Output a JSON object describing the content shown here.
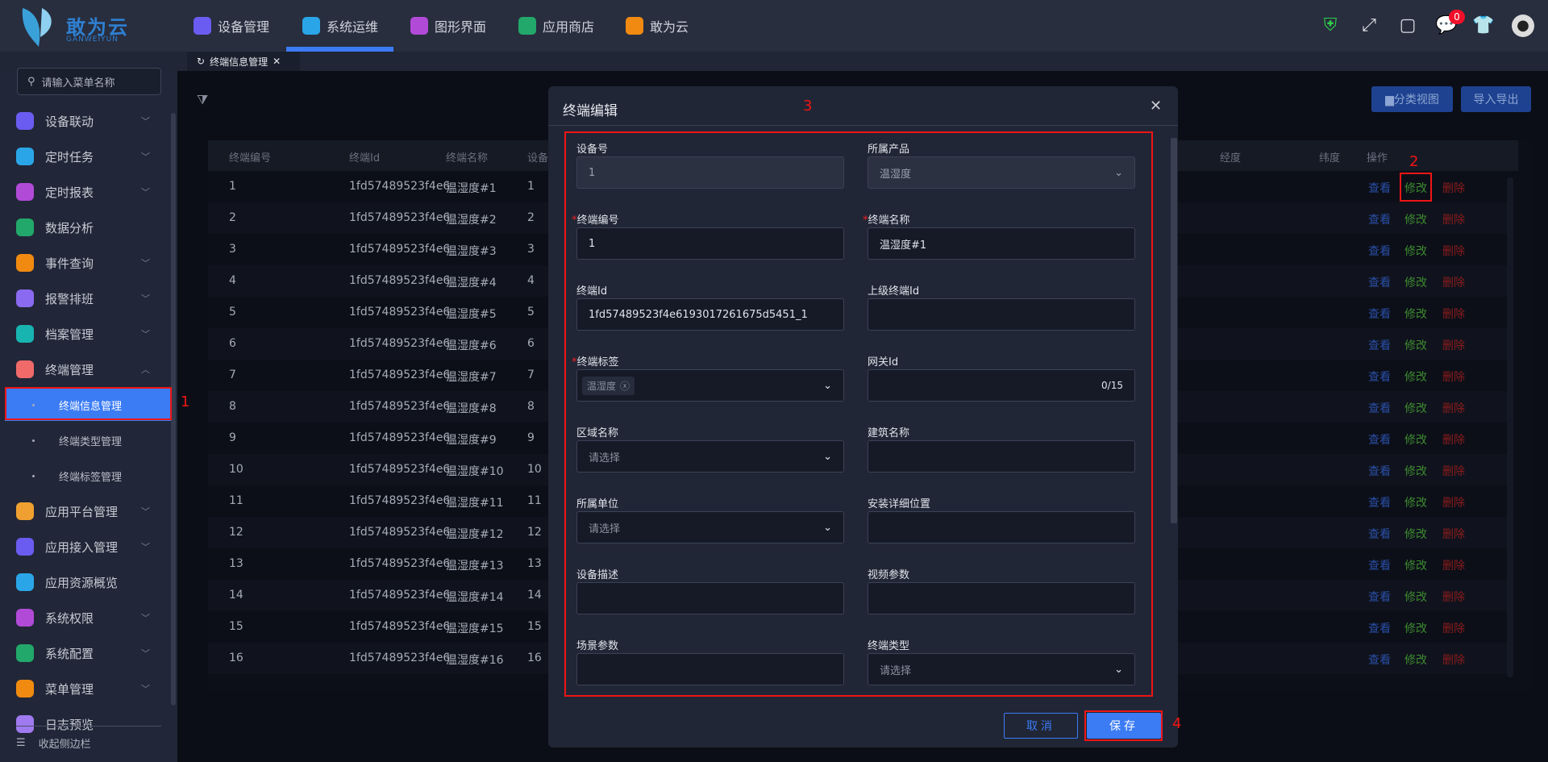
{
  "header": {
    "logo_text": "敢为云",
    "logo_sub": "GANWEIYUN",
    "nav": [
      {
        "label": "设备管理",
        "color": "#6a5cf0"
      },
      {
        "label": "系统运维",
        "color": "#2aa6e8"
      },
      {
        "label": "图形界面",
        "color": "#b24ad8"
      },
      {
        "label": "应用商店",
        "color": "#22a86a"
      },
      {
        "label": "敢为云",
        "color": "#f08a10"
      }
    ],
    "message_count": "0"
  },
  "tabs": [
    {
      "label": "终端信息管理",
      "close": "✕"
    }
  ],
  "sidebar": {
    "search_placeholder": "请输入菜单名称",
    "items": [
      {
        "label": "设备联动",
        "color": "#6a5cf0",
        "chev": "﹀"
      },
      {
        "label": "定时任务",
        "color": "#2aa6e8",
        "chev": "﹀"
      },
      {
        "label": "定时报表",
        "color": "#b24ad8",
        "chev": "﹀"
      },
      {
        "label": "数据分析",
        "color": "#22a86a",
        "chev": ""
      },
      {
        "label": "事件查询",
        "color": "#f08a10",
        "chev": "﹀"
      },
      {
        "label": "报警排班",
        "color": "#8a6af0",
        "chev": "﹀"
      },
      {
        "label": "档案管理",
        "color": "#18b4b0",
        "chev": "﹀"
      },
      {
        "label": "终端管理",
        "color": "#f06a6a",
        "chev": "︿"
      }
    ],
    "subitems": [
      "终端信息管理",
      "终端类型管理",
      "终端标签管理"
    ],
    "items2": [
      {
        "label": "应用平台管理",
        "color": "#f0a030",
        "chev": "﹀"
      },
      {
        "label": "应用接入管理",
        "color": "#6a5cf0",
        "chev": "﹀"
      },
      {
        "label": "应用资源概览",
        "color": "#2aa6e8",
        "chev": ""
      },
      {
        "label": "系统权限",
        "color": "#b24ad8",
        "chev": "﹀"
      },
      {
        "label": "系统配置",
        "color": "#22a86a",
        "chev": "﹀"
      },
      {
        "label": "菜单管理",
        "color": "#f08a10",
        "chev": "﹀"
      },
      {
        "label": "日志预览",
        "color": "#a07af0",
        "chev": ""
      }
    ],
    "collapse_label": "收起侧边栏"
  },
  "toolbar": {
    "category_view": "▆分类视图",
    "import_export": "导入导出"
  },
  "table": {
    "columns": [
      "终端编号",
      "终端Id",
      "终端名称",
      "设备",
      "经度",
      "纬度",
      "操作"
    ],
    "rows": [
      [
        "1",
        "1fd57489523f4e6",
        "温湿度#1",
        "1"
      ],
      [
        "2",
        "1fd57489523f4e6",
        "温湿度#2",
        "2"
      ],
      [
        "3",
        "1fd57489523f4e6",
        "温湿度#3",
        "3"
      ],
      [
        "4",
        "1fd57489523f4e6",
        "温湿度#4",
        "4"
      ],
      [
        "5",
        "1fd57489523f4e6",
        "温湿度#5",
        "5"
      ],
      [
        "6",
        "1fd57489523f4e6",
        "温湿度#6",
        "6"
      ],
      [
        "7",
        "1fd57489523f4e6",
        "温湿度#7",
        "7"
      ],
      [
        "8",
        "1fd57489523f4e6",
        "温湿度#8",
        "8"
      ],
      [
        "9",
        "1fd57489523f4e6",
        "温湿度#9",
        "9"
      ],
      [
        "10",
        "1fd57489523f4e6",
        "温湿度#10",
        "10"
      ],
      [
        "11",
        "1fd57489523f4e6",
        "温湿度#11",
        "11"
      ],
      [
        "12",
        "1fd57489523f4e6",
        "温湿度#12",
        "12"
      ],
      [
        "13",
        "1fd57489523f4e6",
        "温湿度#13",
        "13"
      ],
      [
        "14",
        "1fd57489523f4e6",
        "温湿度#14",
        "14"
      ],
      [
        "15",
        "1fd57489523f4e6",
        "温湿度#15",
        "15"
      ],
      [
        "16",
        "1fd57489523f4e6",
        "温湿度#16",
        "16"
      ]
    ],
    "actions": {
      "view": "查看",
      "edit": "修改",
      "delete": "删除"
    }
  },
  "modal": {
    "title": "终端编辑",
    "fields": [
      {
        "label": "设备号",
        "required": false,
        "value": "1",
        "placeholder": "",
        "type": "disabled"
      },
      {
        "label": "所属产品",
        "required": false,
        "value": "温湿度",
        "placeholder": "",
        "type": "select-disabled"
      },
      {
        "label": "终端编号",
        "required": true,
        "value": "1",
        "placeholder": "",
        "type": "input"
      },
      {
        "label": "终端名称",
        "required": true,
        "value": "温湿度#1",
        "placeholder": "",
        "type": "input"
      },
      {
        "label": "终端Id",
        "required": false,
        "value": "1fd57489523f4e6193017261675d5451_1",
        "placeholder": "",
        "type": "input"
      },
      {
        "label": "上级终端Id",
        "required": false,
        "value": "",
        "placeholder": "",
        "type": "input"
      },
      {
        "label": "终端标签",
        "required": true,
        "value": "温湿度",
        "placeholder": "",
        "type": "tags"
      },
      {
        "label": "网关Id",
        "required": false,
        "value": "",
        "placeholder": "",
        "type": "counter",
        "counter": "0/15"
      },
      {
        "label": "区域名称",
        "required": false,
        "value": "",
        "placeholder": "请选择",
        "type": "select"
      },
      {
        "label": "建筑名称",
        "required": false,
        "value": "",
        "placeholder": "",
        "type": "input"
      },
      {
        "label": "所属单位",
        "required": false,
        "value": "",
        "placeholder": "请选择",
        "type": "select"
      },
      {
        "label": "安装详细位置",
        "required": false,
        "value": "",
        "placeholder": "",
        "type": "input"
      },
      {
        "label": "设备描述",
        "required": false,
        "value": "",
        "placeholder": "",
        "type": "input"
      },
      {
        "label": "视频参数",
        "required": false,
        "value": "",
        "placeholder": "",
        "type": "input"
      },
      {
        "label": "场景参数",
        "required": false,
        "value": "",
        "placeholder": "",
        "type": "input"
      },
      {
        "label": "终端类型",
        "required": false,
        "value": "",
        "placeholder": "请选择",
        "type": "select"
      }
    ],
    "cancel": "取消",
    "save": "保存"
  },
  "annotations": [
    "1",
    "2",
    "3",
    "4"
  ]
}
